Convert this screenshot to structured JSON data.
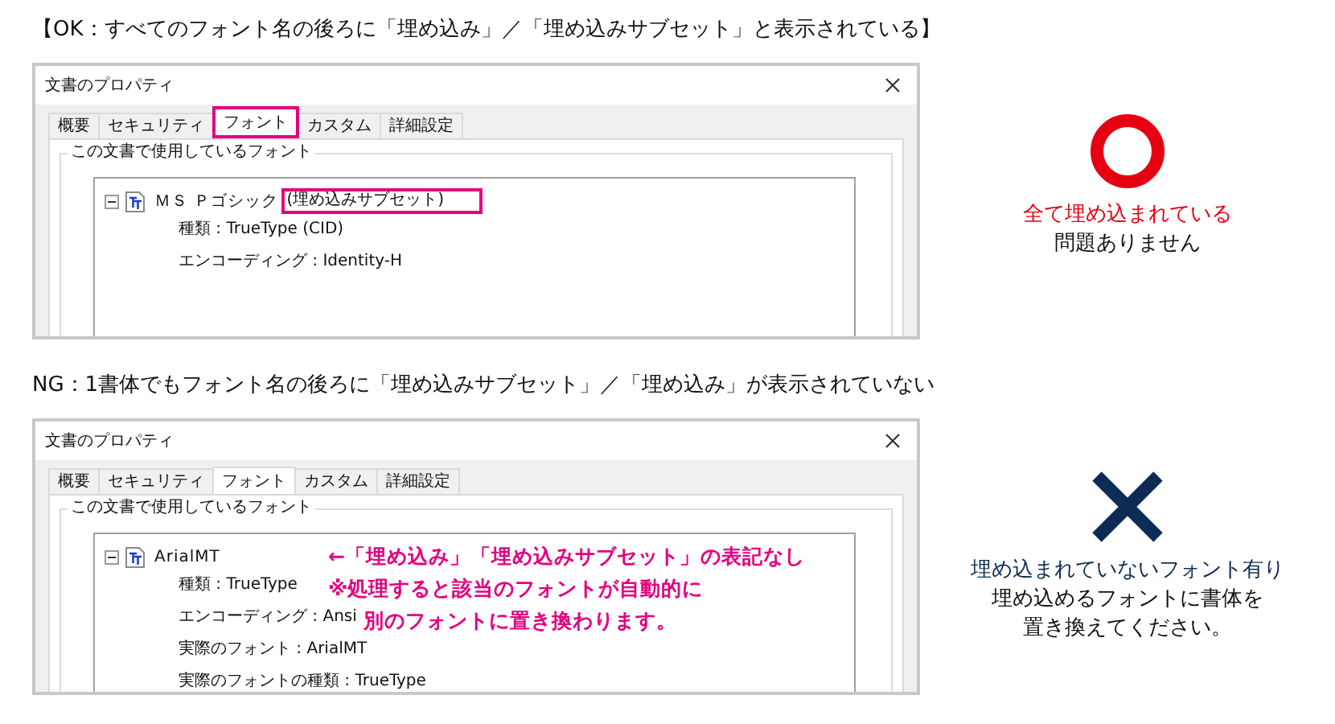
{
  "sections": [
    {
      "heading": "【OK：すべてのフォント名の後ろに「埋め込み」／「埋め込みサブセット」と表示されている】",
      "dialog": {
        "title": "文書のプロパティ",
        "tabs": [
          {
            "label": "概要",
            "selected": false,
            "highlighted": false
          },
          {
            "label": "セキュリティ",
            "selected": false,
            "highlighted": false
          },
          {
            "label": "フォント",
            "selected": true,
            "highlighted": true
          },
          {
            "label": "カスタム",
            "selected": false,
            "highlighted": false
          },
          {
            "label": "詳細設定",
            "selected": false,
            "highlighted": false
          }
        ],
        "group_label": "この文書で使用しているフォント",
        "fonts": [
          {
            "name": "ＭＳ Ｐゴシック",
            "embed_tag": "(埋め込みサブセット)",
            "expanded": true,
            "properties": [
              "種類 : TrueType (CID)",
              "エンコーディング : Identity-H"
            ]
          }
        ]
      },
      "verdict": {
        "kind": "ok",
        "lines": [
          {
            "text": "全て埋め込まれている",
            "emphasis": true
          },
          {
            "text": "問題ありません",
            "emphasis": false
          }
        ]
      }
    },
    {
      "heading": "NG：1書体でもフォント名の後ろに「埋め込みサブセット」／「埋め込み」が表示されていない",
      "dialog": {
        "title": "文書のプロパティ",
        "tabs": [
          {
            "label": "概要",
            "selected": false,
            "highlighted": false
          },
          {
            "label": "セキュリティ",
            "selected": false,
            "highlighted": false
          },
          {
            "label": "フォント",
            "selected": true,
            "highlighted": false
          },
          {
            "label": "カスタム",
            "selected": false,
            "highlighted": false
          },
          {
            "label": "詳細設定",
            "selected": false,
            "highlighted": false
          }
        ],
        "group_label": "この文書で使用しているフォント",
        "fonts": [
          {
            "name": "ArialMT",
            "expanded": true,
            "properties": [
              "種類 : TrueType",
              "エンコーディング : Ansi",
              "実際のフォント : ArialMT",
              "実際のフォントの種類 : TrueType"
            ]
          }
        ],
        "callout": [
          "←「埋め込み」「埋め込みサブセット」の表記なし",
          "※処理すると該当のフォントが自動的に",
          "別のフォントに置き換わります。"
        ]
      },
      "verdict": {
        "kind": "ng",
        "lines": [
          {
            "text": "埋め込まれていないフォント有り",
            "emphasis": true
          },
          {
            "text": "埋め込めるフォントに書体を",
            "emphasis": false
          },
          {
            "text": "置き換えてください。",
            "emphasis": false
          }
        ]
      }
    }
  ]
}
